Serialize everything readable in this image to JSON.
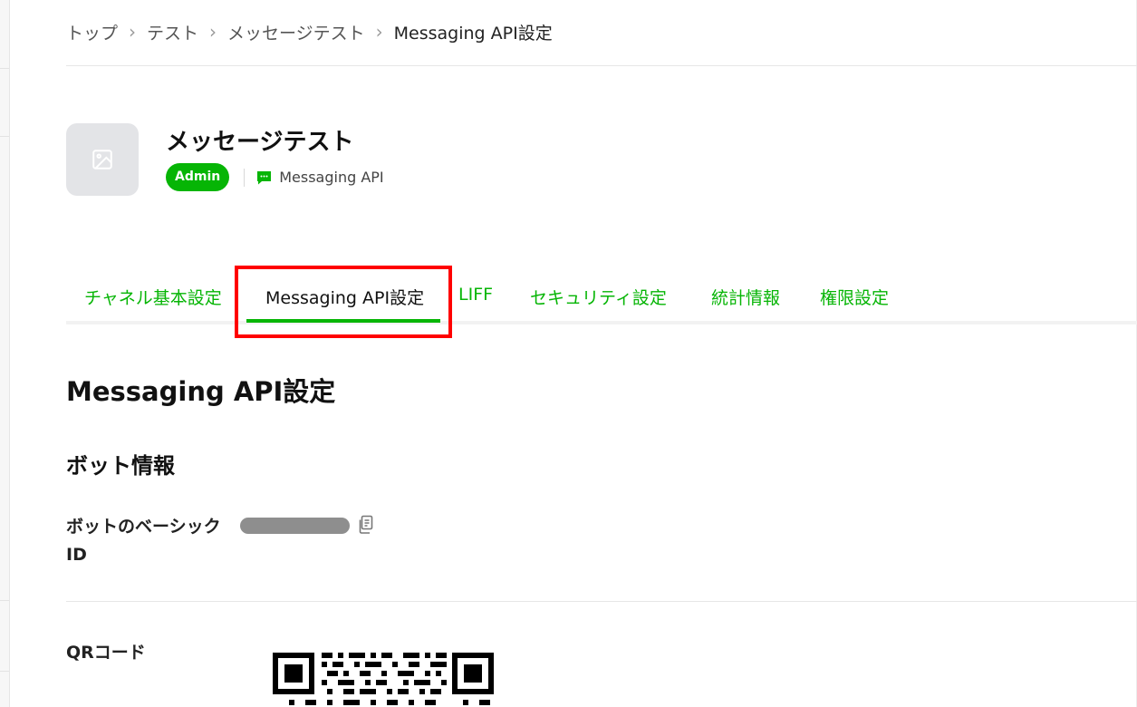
{
  "breadcrumb": {
    "items": [
      "トップ",
      "テスト",
      "メッセージテスト"
    ],
    "current": "Messaging API設定",
    "separator": "›"
  },
  "channel": {
    "name": "メッセージテスト",
    "role_badge": "Admin",
    "type_label": "Messaging API"
  },
  "tabs": [
    {
      "label": "チャネル基本設定",
      "active": false
    },
    {
      "label": "Messaging API設定",
      "active": true
    },
    {
      "label": "LIFF",
      "active": false
    },
    {
      "label": "セキュリティ設定",
      "active": false
    },
    {
      "label": "統計情報",
      "active": false
    },
    {
      "label": "権限設定",
      "active": false
    }
  ],
  "page": {
    "title": "Messaging API設定",
    "section": "ボット情報",
    "bot_basic_id_label": "ボットのベーシックID",
    "qr_label": "QRコード"
  },
  "colors": {
    "accent": "#06b505",
    "highlight": "#ff0000",
    "placeholder": "#e3e4e7"
  },
  "icons": {
    "thumbnail": "image-placeholder-icon",
    "type": "chat-bubble-icon",
    "copy": "copy-icon"
  }
}
